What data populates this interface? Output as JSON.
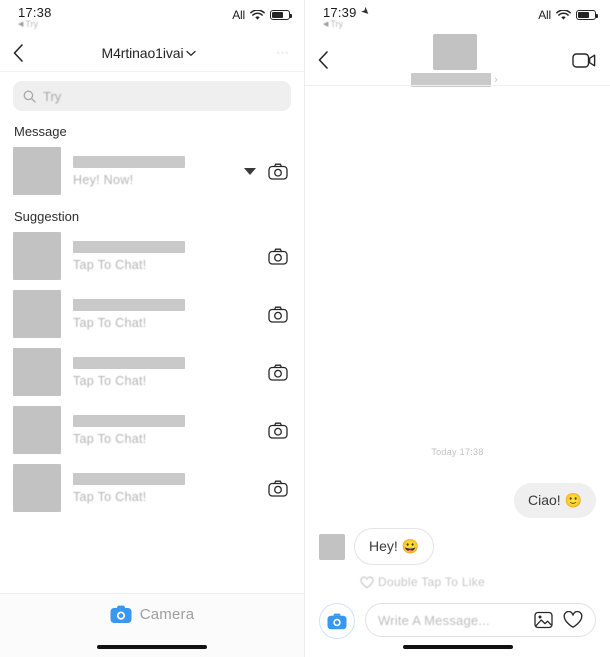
{
  "left": {
    "status": {
      "time": "17:38",
      "sub_label": "Try",
      "carrier": "All",
      "wifi_icon": "wifi-icon",
      "battery_icon": "battery-icon"
    },
    "nav": {
      "back_icon": "chevron-left-icon",
      "title": "M4rtinao1ivai",
      "title_chevron": "chevron-down-icon",
      "menu_icon": "more-options-icon"
    },
    "search": {
      "placeholder": "Try",
      "icon": "search-icon"
    },
    "sections": [
      {
        "title": "Message",
        "rows": [
          {
            "subtitle": "Hey! Now!",
            "avatar": "avatar-placeholder",
            "has_caret": true,
            "camera_icon": "camera-outline-icon"
          }
        ]
      },
      {
        "title": "Suggestion",
        "rows": [
          {
            "subtitle": "Tap To Chat!",
            "avatar": "avatar-placeholder",
            "has_caret": false,
            "camera_icon": "camera-outline-icon"
          },
          {
            "subtitle": "Tap To Chat!",
            "avatar": "avatar-placeholder",
            "has_caret": false,
            "camera_icon": "camera-outline-icon"
          },
          {
            "subtitle": "Tap To Chat!",
            "avatar": "avatar-placeholder",
            "has_caret": false,
            "camera_icon": "camera-outline-icon"
          },
          {
            "subtitle": "Tap To Chat!",
            "avatar": "avatar-placeholder",
            "has_caret": false,
            "camera_icon": "camera-outline-icon"
          },
          {
            "subtitle": "Tap To Chat!",
            "avatar": "avatar-placeholder",
            "has_caret": false,
            "camera_icon": "camera-outline-icon"
          }
        ]
      }
    ],
    "tabbar": {
      "camera_label": "Camera",
      "camera_icon": "camera-filled-icon"
    }
  },
  "right": {
    "status": {
      "time": "17:39",
      "location_icon": "location-arrow-icon",
      "sub_label": "Try",
      "carrier": "All",
      "wifi_icon": "wifi-icon",
      "battery_icon": "battery-icon"
    },
    "nav": {
      "back_icon": "chevron-left-icon",
      "avatar": "avatar-placeholder",
      "name_chevron": "chevron-right-icon",
      "video_icon": "video-camera-icon"
    },
    "chat": {
      "timestamp": "Today 17:38",
      "messages": [
        {
          "direction": "out",
          "text": "Ciao! 🙂"
        },
        {
          "direction": "in",
          "text": "Hey! 😀"
        }
      ],
      "like_hint": "Double Tap To Like",
      "like_hint_icon": "heart-outline-icon"
    },
    "composer": {
      "camera_icon": "camera-filled-icon",
      "placeholder": "Write A Message...",
      "gallery_icon": "image-icon",
      "heart_icon": "heart-outline-icon"
    }
  },
  "colors": {
    "accent_blue": "#3897f0",
    "bubble_gray": "#efefef",
    "placeholder_gray": "#c2c2c2",
    "text_dark": "#262626"
  }
}
